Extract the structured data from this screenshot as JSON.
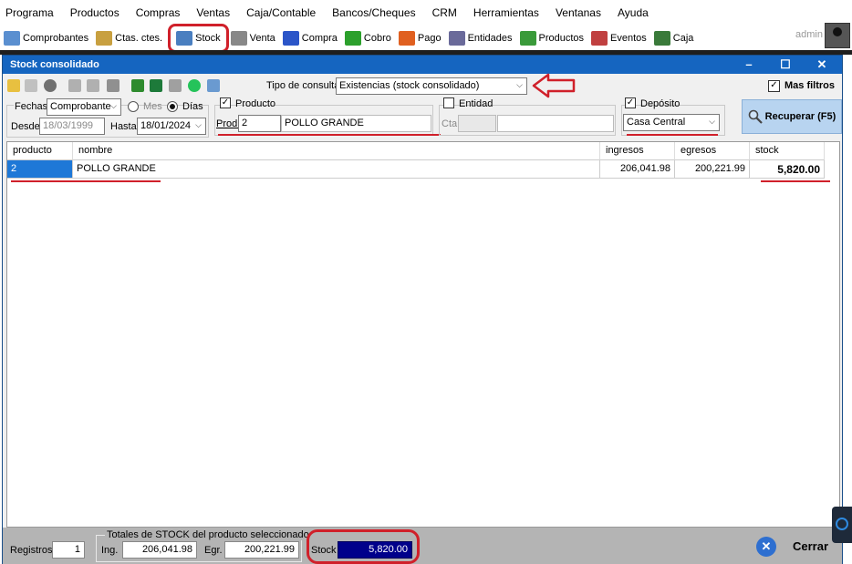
{
  "menu": [
    "Programa",
    "Productos",
    "Compras",
    "Ventas",
    "Caja/Contable",
    "Bancos/Cheques",
    "CRM",
    "Herramientas",
    "Ventanas",
    "Ayuda"
  ],
  "toolbar": [
    {
      "label": "Comprobantes",
      "icon": "document-icon",
      "color": "#5a8fd0"
    },
    {
      "label": "Ctas. ctes.",
      "icon": "books-icon",
      "color": "#c8a040"
    },
    {
      "label": "Stock",
      "icon": "stock-icon",
      "color": "#4a7fc0"
    },
    {
      "label": "Venta",
      "icon": "printer-icon",
      "color": "#888888"
    },
    {
      "label": "Compra",
      "icon": "cart-icon",
      "color": "#2b55c8"
    },
    {
      "label": "Cobro",
      "icon": "dollar-in-icon",
      "color": "#2ca02c"
    },
    {
      "label": "Pago",
      "icon": "dollar-out-icon",
      "color": "#e06020"
    },
    {
      "label": "Entidades",
      "icon": "contacts-icon",
      "color": "#6a6a9a"
    },
    {
      "label": "Productos",
      "icon": "box-icon",
      "color": "#3a9a3a"
    },
    {
      "label": "Eventos",
      "icon": "calendar-icon",
      "color": "#c04040"
    },
    {
      "label": "Caja",
      "icon": "money-icon",
      "color": "#3a7a3a"
    }
  ],
  "user": {
    "name": "admin"
  },
  "window": {
    "title": "Stock consolidado",
    "controls": {
      "minimize": "–",
      "maximize": "☐",
      "close": "✕"
    }
  },
  "filters": {
    "tipo_consulta_label": "Tipo de consulta",
    "tipo_consulta_value": "Existencias (stock consolidado)",
    "mas_filtros_label": "Mas filtros",
    "fechas_label": "Fechas",
    "fechas_value": "Comprobante",
    "mes_label": "Mes",
    "dias_label": "Días",
    "desde_label": "Desde",
    "desde_value": "18/03/1999",
    "hasta_label": "Hasta",
    "hasta_value": "18/01/2024",
    "producto_label": "Producto",
    "prod_label": "Prod.",
    "prod_code": "2",
    "prod_name": "POLLO GRANDE",
    "entidad_label": "Entidad",
    "cta_label": "Cta",
    "deposito_label": "Depósito",
    "deposito_value": "Casa Central",
    "recuperar_label": "Recuperar (F5)"
  },
  "table": {
    "columns": [
      "producto",
      "nombre",
      "ingresos",
      "egresos",
      "stock"
    ],
    "rows": [
      {
        "producto": "2",
        "nombre": "POLLO GRANDE",
        "ingresos": "206,041.98",
        "egresos": "200,221.99",
        "stock": "5,820.00"
      }
    ]
  },
  "footer": {
    "registros_label": "Registros",
    "registros_value": "1",
    "totales_label": "Totales de STOCK del producto seleccionado",
    "ing_label": "Ing.",
    "ing_value": "206,041.98",
    "egr_label": "Egr.",
    "egr_value": "200,221.99",
    "stock_label": "Stock",
    "stock_value": "5,820.00",
    "cerrar_label": "Cerrar"
  },
  "colors": {
    "titlebar": "#1565c0",
    "highlight": "#d0202a",
    "selected_cell": "#1e78d7",
    "stock_box": "#00008b"
  }
}
